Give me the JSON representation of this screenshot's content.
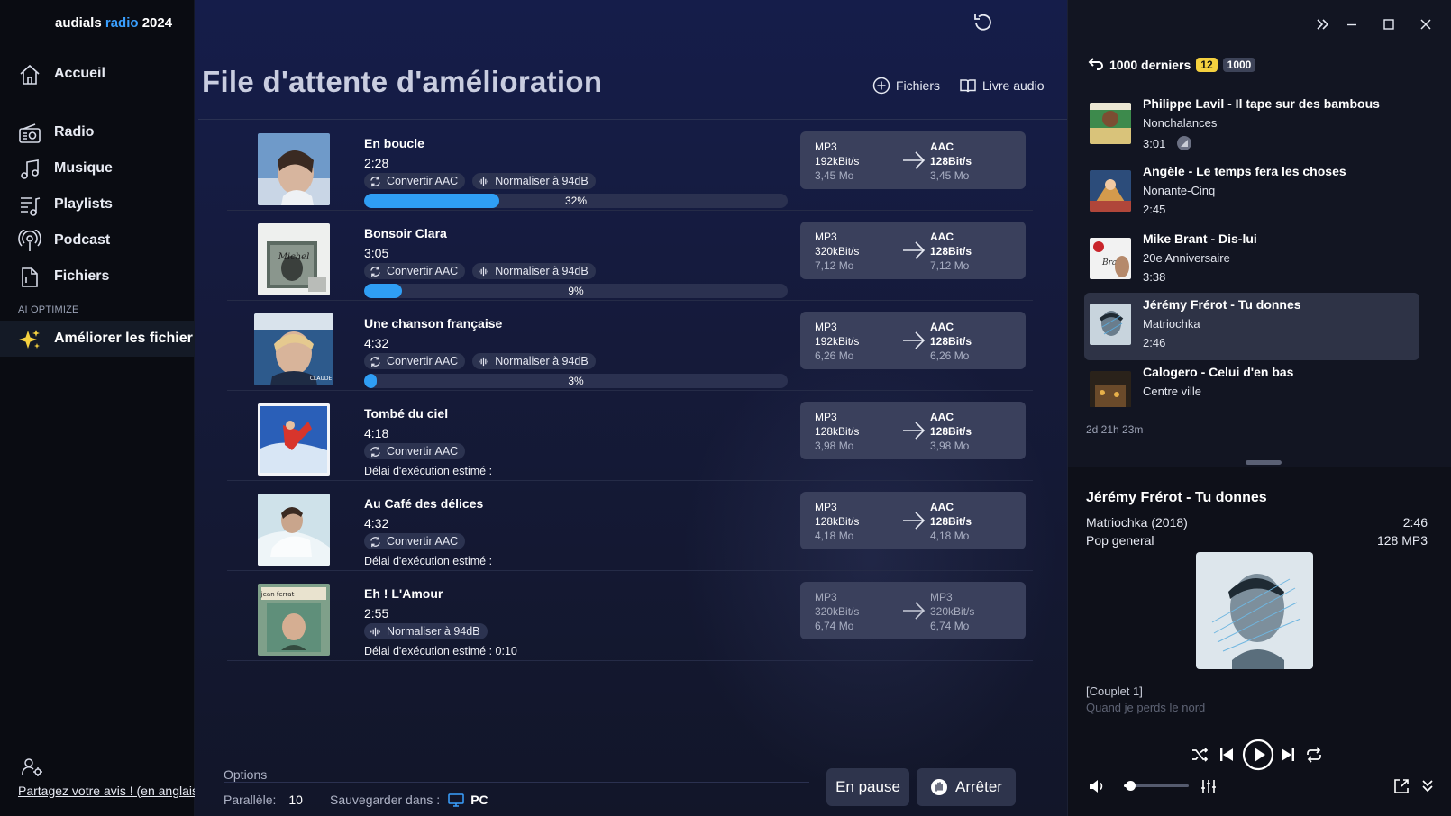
{
  "sidebar": {
    "brand": {
      "part1": "audials",
      "part2": "radio",
      "part3": "2024"
    },
    "items": [
      {
        "label": "Accueil",
        "icon": "home-icon"
      },
      {
        "label": "Radio",
        "icon": "radio-icon"
      },
      {
        "label": "Musique",
        "icon": "music-note-icon"
      },
      {
        "label": "Playlists",
        "icon": "playlist-icon"
      },
      {
        "label": "Podcast",
        "icon": "podcast-icon"
      },
      {
        "label": "Fichiers",
        "icon": "file-icon"
      }
    ],
    "section_label": "AI OPTIMIZE",
    "active_item": {
      "label": "Améliorer les fichier",
      "icon": "sparkle-icon"
    },
    "feedback_link": "Partagez votre avis ! (en anglais"
  },
  "main": {
    "title": "File d'attente d'amélioration",
    "buttons": {
      "files": "Fichiers",
      "audiobook": "Livre audio"
    },
    "rows": [
      {
        "title": "En boucle",
        "duration": "2:28",
        "tags": [
          "Convertir AAC",
          "Normaliser à 94dB"
        ],
        "progress": 32,
        "progress_label": "32%",
        "eta": "",
        "src": {
          "format": "MP3",
          "bitrate": "192kBit/s",
          "size": "3,45 Mo"
        },
        "dst": {
          "format": "AAC",
          "bitrate": "128Bit/s",
          "size": "3,45 Mo"
        }
      },
      {
        "title": "Bonsoir Clara",
        "duration": "3:05",
        "tags": [
          "Convertir AAC",
          "Normaliser à 94dB"
        ],
        "progress": 9,
        "progress_label": "9%",
        "eta": "",
        "src": {
          "format": "MP3",
          "bitrate": "320kBit/s",
          "size": "7,12 Mo"
        },
        "dst": {
          "format": "AAC",
          "bitrate": "128Bit/s",
          "size": "7,12 Mo"
        }
      },
      {
        "title": "Une chanson française",
        "duration": "4:32",
        "tags": [
          "Convertir AAC",
          "Normaliser à 94dB"
        ],
        "progress": 3,
        "progress_label": "3%",
        "eta": "",
        "src": {
          "format": "MP3",
          "bitrate": "192kBit/s",
          "size": "6,26 Mo"
        },
        "dst": {
          "format": "AAC",
          "bitrate": "128Bit/s",
          "size": "6,26 Mo"
        }
      },
      {
        "title": "Tombé du ciel",
        "duration": "4:18",
        "tags": [
          "Convertir AAC"
        ],
        "progress": null,
        "progress_label": "",
        "eta": "Délai d'exécution estimé :",
        "src": {
          "format": "MP3",
          "bitrate": "128kBit/s",
          "size": "3,98 Mo"
        },
        "dst": {
          "format": "AAC",
          "bitrate": "128Bit/s",
          "size": "3,98 Mo"
        }
      },
      {
        "title": "Au Café des délices",
        "duration": "4:32",
        "tags": [
          "Convertir AAC"
        ],
        "progress": null,
        "progress_label": "",
        "eta": "Délai d'exécution estimé :",
        "src": {
          "format": "MP3",
          "bitrate": "128kBit/s",
          "size": "4,18 Mo"
        },
        "dst": {
          "format": "AAC",
          "bitrate": "128Bit/s",
          "size": "4,18 Mo"
        }
      },
      {
        "title": "Eh ! L'Amour",
        "duration": "2:55",
        "tags": [
          "Normaliser à 94dB"
        ],
        "progress": null,
        "progress_label": "",
        "eta": "Délai d'exécution estimé : 0:10",
        "src": {
          "format": "MP3",
          "bitrate": "320kBit/s",
          "size": "6,74 Mo"
        },
        "dst": {
          "format": "MP3",
          "bitrate": "320kBit/s",
          "size": "6,74 Mo"
        }
      }
    ],
    "options": {
      "label": "Options",
      "parallel_label": "Parallèle:",
      "parallel_value": "10",
      "save_label": "Sauvegarder dans :",
      "save_target": "PC"
    },
    "pause_button": "En pause",
    "stop_button": "Arrêter"
  },
  "right_panel": {
    "recent": {
      "label": "1000 derniers",
      "badge_new": "12",
      "badge_total": "1000"
    },
    "items": [
      {
        "title": "Philippe Lavil - Il tape sur des bambous",
        "album": "Nonchalances",
        "duration": "3:01"
      },
      {
        "title": "Angèle - Le temps fera les choses",
        "album": "Nonante-Cinq",
        "duration": "2:45"
      },
      {
        "title": "Mike Brant - Dis-lui",
        "album": "20e Anniversaire",
        "duration": "3:38"
      },
      {
        "title": "Jérémy Frérot - Tu donnes",
        "album": "Matriochka",
        "duration": "2:46"
      },
      {
        "title": "Calogero - Celui d'en bas",
        "album": "Centre ville",
        "duration": ""
      }
    ],
    "total_time": "2d 21h 23m",
    "now_playing": {
      "title": "Jérémy Frérot - Tu donnes",
      "album": "Matriochka (2018)",
      "genre": "Pop general",
      "duration": "2:46",
      "quality": "128 MP3",
      "lyrics_line1": "[Couplet 1]",
      "lyrics_line2": "Quand je perds le nord"
    },
    "volume": 0.1
  },
  "colors": {
    "accent": "#2f9ef5",
    "brand_accent": "#3aa0ff",
    "badge_yellow": "#f4d03f"
  }
}
